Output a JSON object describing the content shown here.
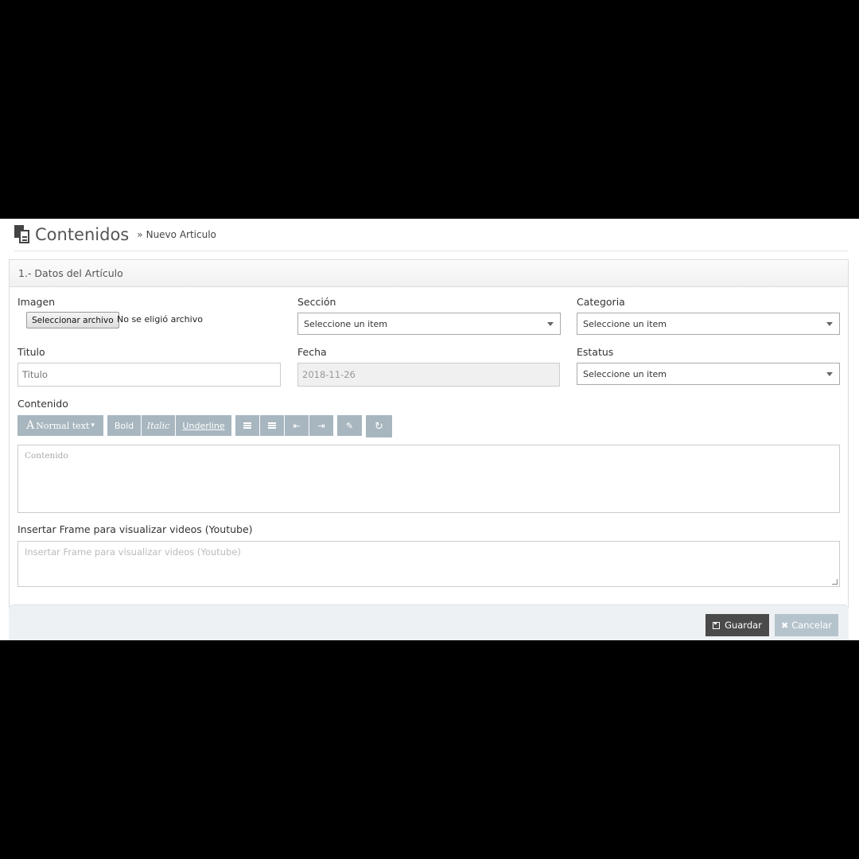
{
  "header": {
    "title": "Contenidos",
    "separator": "»",
    "breadcrumb": "Nuevo Articulo"
  },
  "panel": {
    "heading": "1.- Datos del Artículo"
  },
  "form": {
    "imagen_label": "Imagen",
    "file_button": "Seleccionar archivo",
    "file_status": "No se eligió archivo",
    "seccion_label": "Sección",
    "seccion_value": "Seleccione un item",
    "categoria_label": "Categoria",
    "categoria_value": "Seleccione un item",
    "titulo_label": "Titulo",
    "titulo_placeholder": "Titulo",
    "fecha_label": "Fecha",
    "fecha_value": "2018-11-26",
    "estatus_label": "Estatus",
    "estatus_value": "Seleccione un item",
    "contenido_label": "Contenido",
    "contenido_placeholder": "Contenido",
    "frame_label": "Insertar Frame para visualizar videos (Youtube)",
    "frame_placeholder": "Insertar Frame para visualizar videos (Youtube)"
  },
  "toolbar": {
    "font_glyph": "A",
    "normal_text": "Normal text",
    "dropdown_caret": "▾",
    "bold": "Bold",
    "italic": "Italic",
    "underline": "Underline",
    "icons": [
      "unordered-list-icon",
      "ordered-list-icon",
      "outdent-icon",
      "indent-icon",
      "pencil-icon",
      "redo-icon"
    ],
    "outdent_glyph": "⇤",
    "indent_glyph": "⇥",
    "pencil_glyph": "✎",
    "redo_glyph": "↻"
  },
  "actions": {
    "save": "Guardar",
    "cancel": "Cancelar",
    "cancel_glyph": "✖"
  },
  "colors": {
    "toolbar_button": "#a7b6bf",
    "save_button": "#4a4a4a",
    "cancel_button": "#b5c3cc"
  }
}
